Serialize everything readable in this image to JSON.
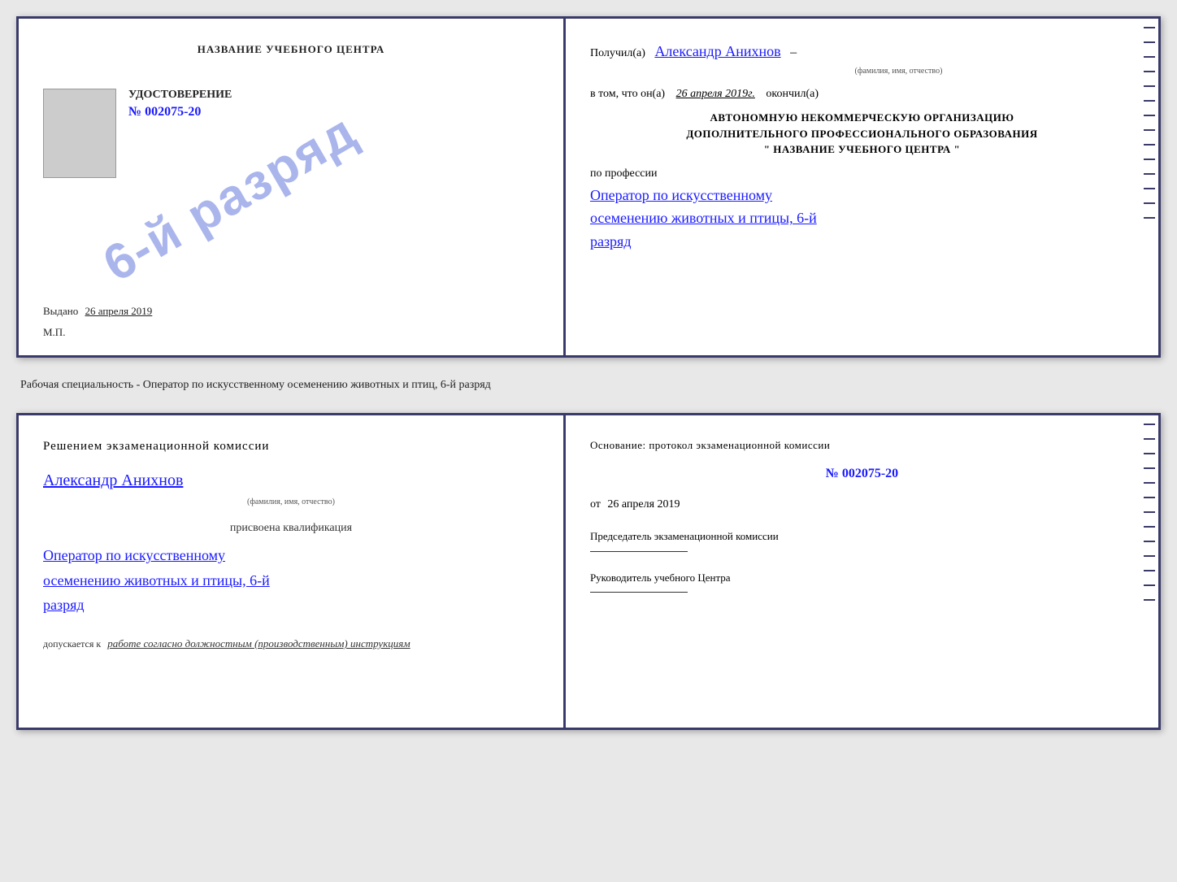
{
  "top_doc": {
    "left": {
      "center_title": "НАЗВАНИЕ УЧЕБНОГО ЦЕНТРА",
      "stamp_text": "6-й разряд",
      "cert_section": {
        "title": "УДОСТОВЕРЕНИЕ",
        "number": "№ 002075-20"
      },
      "vydano_label": "Выдано",
      "vydano_date": "26 апреля 2019",
      "mp_label": "М.П."
    },
    "right": {
      "poluchil_prefix": "Получил(а)",
      "recipient_name": "Александр Анихнов",
      "fio_label": "(фамилия, имя, отчество)",
      "dash1": "–",
      "vtom_prefix": "в том, что он(а)",
      "vtom_date": "26 апреля 2019г.",
      "okonchil": "окончил(а)",
      "org_line1": "АВТОНОМНУЮ НЕКОММЕРЧЕСКУЮ ОРГАНИЗАЦИЮ",
      "org_line2": "ДОПОЛНИТЕЛЬНОГО ПРОФЕССИОНАЛЬНОГО ОБРАЗОВАНИЯ",
      "org_line3": "\"   НАЗВАНИЕ УЧЕБНОГО ЦЕНТРА   \"",
      "po_professii": "по профессии",
      "prof_text_line1": "Оператор по искусственному",
      "prof_text_line2": "осеменению животных и птицы, 6-й",
      "prof_text_line3": "разряд"
    }
  },
  "middle_text": "Рабочая специальность - Оператор по искусственному осеменению животных и птиц, 6-й разряд",
  "bottom_doc": {
    "left": {
      "komissia_text": "Решением экзаменационной комиссии",
      "name": "Александр Анихнов",
      "fio_label": "(фамилия, имя, отчество)",
      "prisvoyena": "присвоена квалификация",
      "qualification_line1": "Оператор по искусственному",
      "qualification_line2": "осеменению животных и птицы, 6-й",
      "qualification_line3": "разряд",
      "dopuskaetsya_prefix": "допускается к",
      "dopuskaetsya_val": "работе согласно должностным (производственным) инструкциям"
    },
    "right": {
      "osnovanie": "Основание: протокол экзаменационной комиссии",
      "protocol_number": "№  002075-20",
      "ot_prefix": "от",
      "ot_date": "26 апреля 2019",
      "chairman_label": "Председатель экзаменационной комиссии",
      "rukovoditel_label": "Руководитель учебного Центра"
    }
  }
}
